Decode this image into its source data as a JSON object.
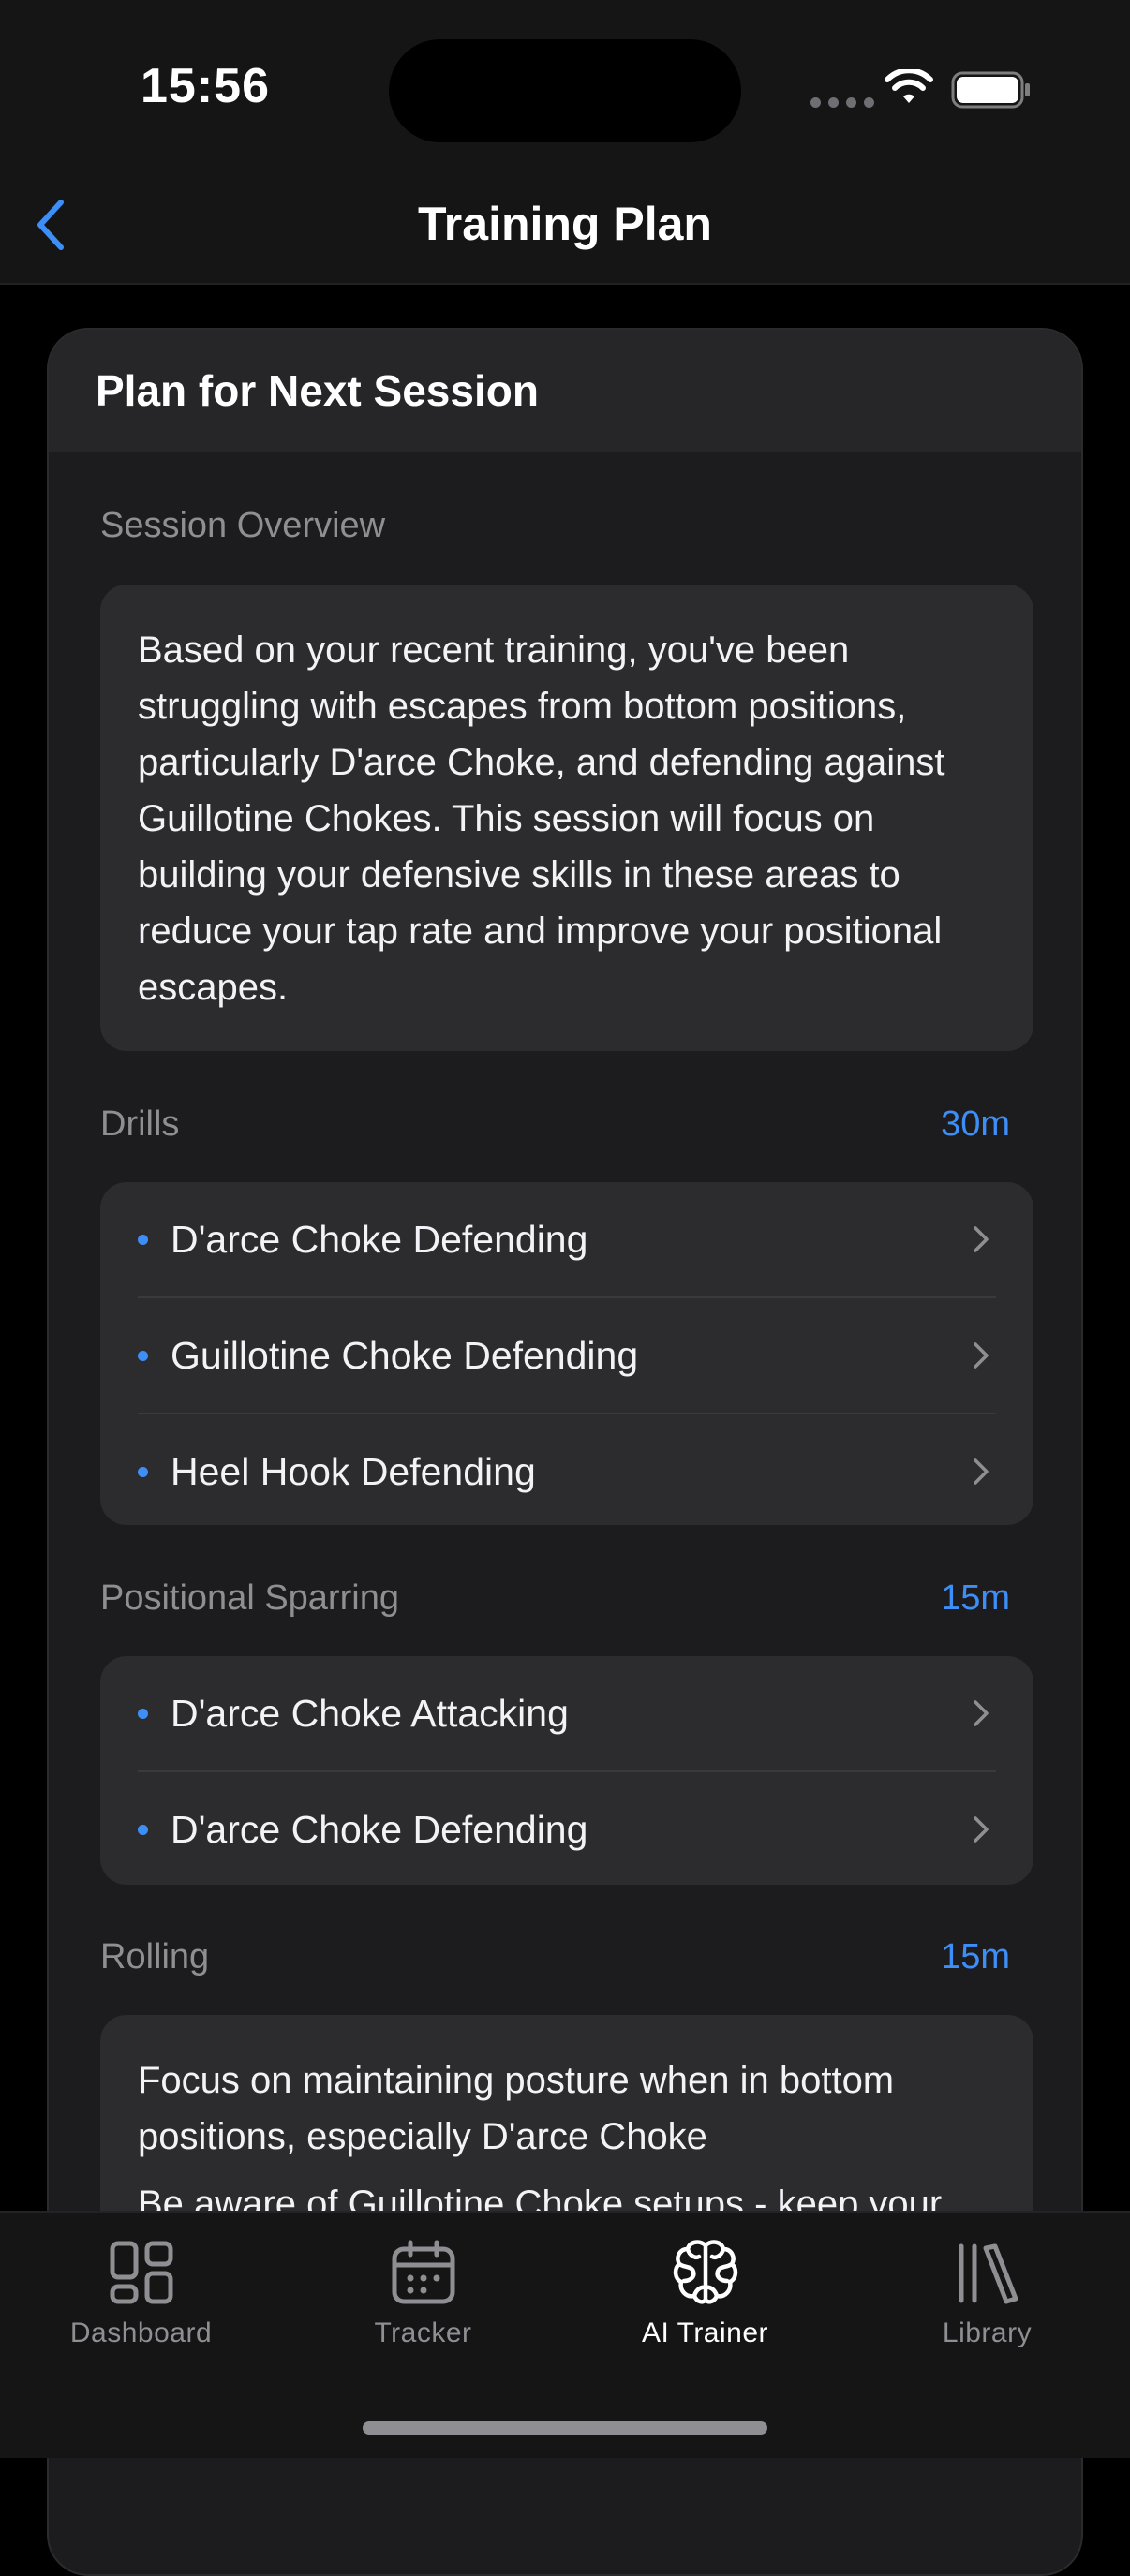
{
  "status": {
    "time": "15:56"
  },
  "nav": {
    "title": "Training Plan",
    "back_icon": "chevron-left-icon"
  },
  "card": {
    "title": "Plan for Next Session"
  },
  "overview": {
    "label": "Session Overview",
    "text": "Based on your recent training, you've been struggling with escapes from bottom positions, particularly D'arce Choke, and defending against Guillotine Chokes. This session will focus on building your defensive skills in these areas to reduce your tap rate and improve your positional escapes."
  },
  "drills": {
    "label": "Drills",
    "duration": "30m",
    "items": [
      {
        "label": "D'arce Choke Defending"
      },
      {
        "label": "Guillotine Choke Defending"
      },
      {
        "label": "Heel Hook Defending"
      }
    ]
  },
  "sparring": {
    "label": "Positional Sparring",
    "duration": "15m",
    "items": [
      {
        "label": "D'arce Choke Attacking"
      },
      {
        "label": "D'arce Choke Defending"
      }
    ]
  },
  "rolling": {
    "label": "Rolling",
    "duration": "15m",
    "lines": [
      "Focus on maintaining posture when in bottom positions, especially D'arce Choke",
      "Be aware of Guillotine Choke setups - keep your"
    ]
  },
  "tabs": [
    {
      "label": "Dashboard",
      "icon": "dashboard-grid-icon",
      "active": false
    },
    {
      "label": "Tracker",
      "icon": "calendar-icon",
      "active": false
    },
    {
      "label": "AI Trainer",
      "icon": "brain-icon",
      "active": true
    },
    {
      "label": "Library",
      "icon": "library-books-icon",
      "active": false
    }
  ],
  "colors": {
    "accent": "#3d8ef7",
    "background": "#000000",
    "card": "#1c1c1e",
    "panel": "#2c2c2e",
    "secondary_text": "#8e8e93"
  }
}
